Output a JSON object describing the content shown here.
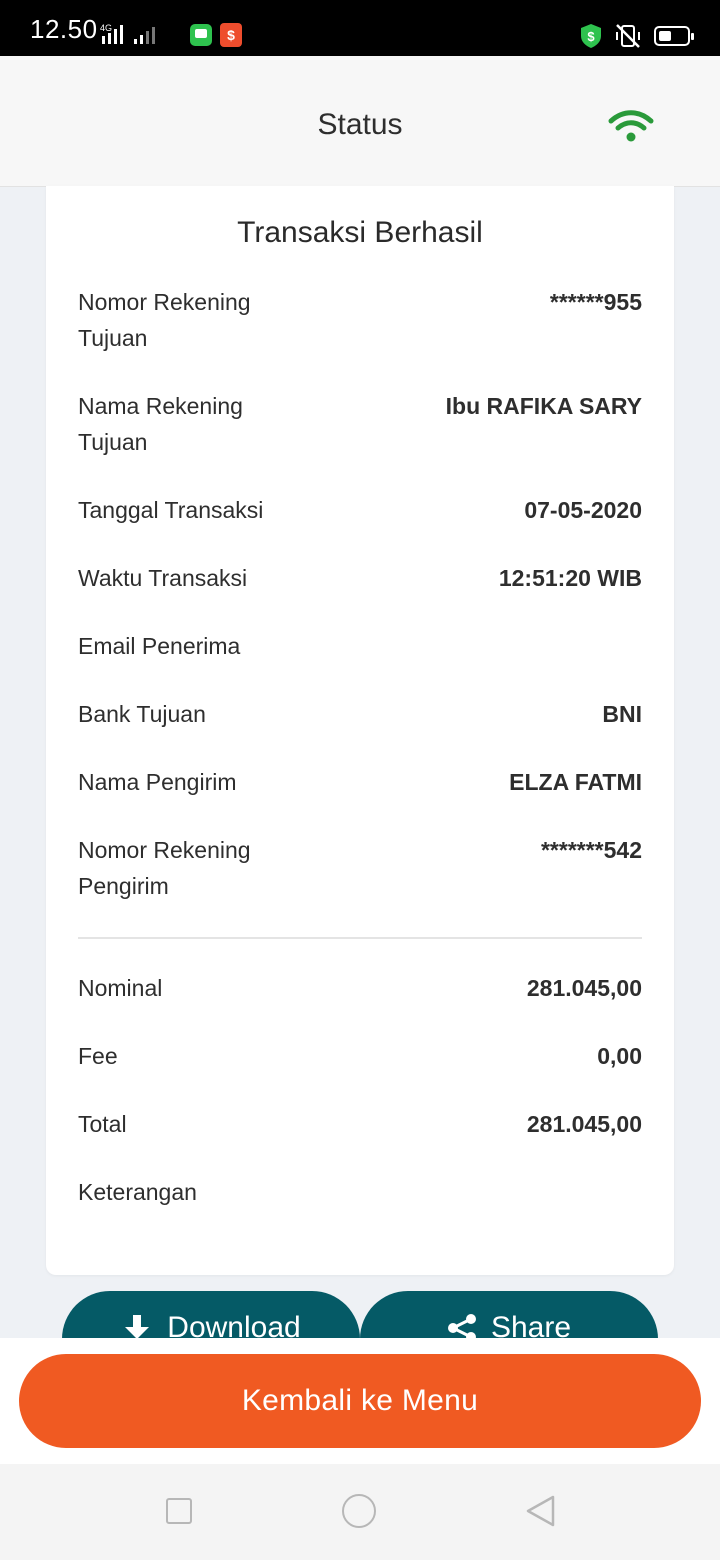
{
  "status_bar": {
    "time": "12.50",
    "network": "4G",
    "battery_level": 0.45
  },
  "header": {
    "title": "Status",
    "wifi_color": "#2a9a3a"
  },
  "card": {
    "title": "Transaksi Berhasil",
    "details": [
      {
        "label": "Nomor Rekening Tujuan",
        "value": "******955"
      },
      {
        "label": "Nama Rekening Tujuan",
        "value": "Ibu RAFIKA SARY"
      },
      {
        "label": "Tanggal Transaksi",
        "value": "07-05-2020"
      },
      {
        "label": "Waktu Transaksi",
        "value": "12:51:20 WIB"
      },
      {
        "label": "Email Penerima",
        "value": ""
      },
      {
        "label": "Bank Tujuan",
        "value": "BNI"
      },
      {
        "label": "Nama Pengirim",
        "value": "ELZA FATMI"
      },
      {
        "label": "Nomor Rekening Pengirim",
        "value": "*******542"
      }
    ],
    "summary": [
      {
        "label": "Nominal",
        "value": "281.045,00"
      },
      {
        "label": "Fee",
        "value": "0,00"
      },
      {
        "label": "Total",
        "value": "281.045,00"
      },
      {
        "label": "Keterangan",
        "value": ""
      }
    ]
  },
  "actions": {
    "download_label": "Download",
    "share_label": "Share"
  },
  "footer": {
    "menu_button_label": "Kembali ke Menu",
    "accent_color": "#f05a22",
    "action_color": "#055a66"
  }
}
